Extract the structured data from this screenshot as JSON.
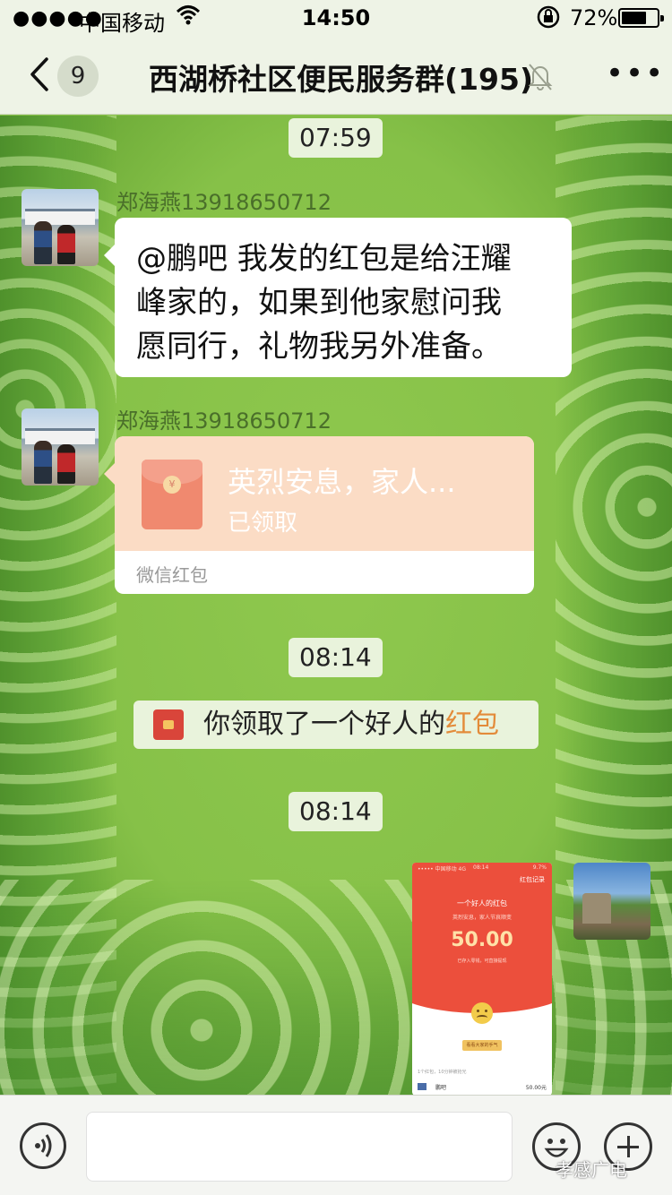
{
  "status": {
    "signal_dots": "●●●●●",
    "carrier": "中国移动",
    "time": "14:50",
    "battery": "72%",
    "battery_level": 0.72
  },
  "nav": {
    "unread_badge": "9",
    "title": "西湖桥社区便民服务群(195)"
  },
  "chat": {
    "times": [
      "07:59",
      "08:14",
      "08:14"
    ],
    "messages": [
      {
        "sender": "郑海燕13918650712",
        "text_lines": [
          "@鹏吧 我发的红包是给汪耀",
          "峰家的，如果到他家慰问我",
          "愿同行，礼物我另外准备。"
        ]
      },
      {
        "sender": "郑海燕13918650712",
        "hongbao": {
          "message": "英烈安息，家人...",
          "status": "已领取",
          "footer": "微信红包",
          "coin": "¥"
        }
      }
    ],
    "system_notice": {
      "prefix": "你领取了一个好人的",
      "highlight": "红包"
    },
    "screenshot": {
      "header_left": "••••• 中国移动 4G",
      "header_time": "08:14",
      "header_right": "9.7%",
      "record_label": "红包记录",
      "name": "一个好人的红包",
      "sub": "英烈安息，家人节哀顺变",
      "amount": "50.00",
      "note": "已存入零钱，可直接提现",
      "button": "看看大家的手气",
      "count": "1个红包，10分钟被抢光",
      "row_name": "鹏吧",
      "row_value": "50.00元"
    }
  },
  "watermark": "孝感广电"
}
